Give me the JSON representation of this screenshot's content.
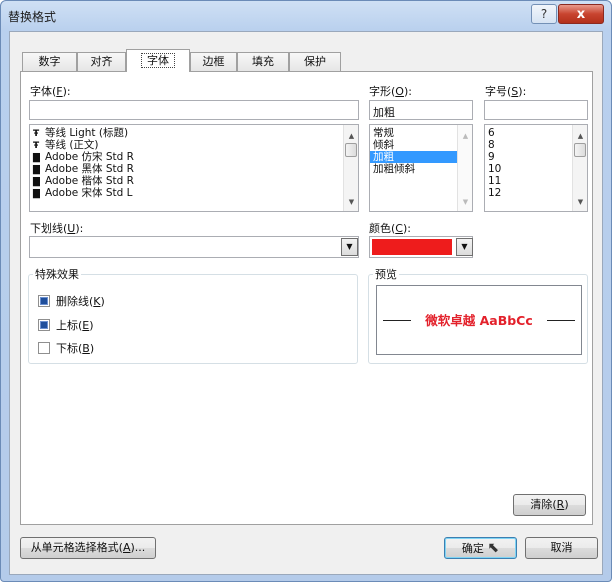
{
  "window": {
    "title": "替换格式",
    "help_glyph": "?",
    "close_glyph": "x"
  },
  "tabs": [
    {
      "label": "数字",
      "active": false
    },
    {
      "label": "对齐",
      "active": false
    },
    {
      "label": "字体",
      "active": true
    },
    {
      "label": "边框",
      "active": false
    },
    {
      "label": "填充",
      "active": false
    },
    {
      "label": "保护",
      "active": false
    }
  ],
  "font": {
    "label": "字体(",
    "key": "F",
    "label_end": "):",
    "value": "",
    "items": [
      {
        "icon": "Tr",
        "name": "等线 Light (标题)"
      },
      {
        "icon": "Tr",
        "name": "等线 (正文)"
      },
      {
        "icon": "printer",
        "name": "Adobe 仿宋 Std R"
      },
      {
        "icon": "printer",
        "name": "Adobe 黑体 Std R"
      },
      {
        "icon": "printer",
        "name": "Adobe 楷体 Std R"
      },
      {
        "icon": "printer",
        "name": "Adobe 宋体 Std L"
      }
    ]
  },
  "style": {
    "label": "字形(",
    "key": "O",
    "label_end": "):",
    "value": "加粗",
    "items": [
      "常规",
      "倾斜",
      "加粗",
      "加粗倾斜"
    ],
    "selected_index": 2
  },
  "size": {
    "label": "字号(",
    "key": "S",
    "label_end": "):",
    "value": "",
    "items": [
      "6",
      "8",
      "9",
      "10",
      "11",
      "12"
    ]
  },
  "underline": {
    "label": "下划线(",
    "key": "U",
    "label_end": "):",
    "value": ""
  },
  "color": {
    "label": "颜色(",
    "key": "C",
    "label_end": "):",
    "value_hex": "#ee1c1c"
  },
  "effects": {
    "legend": "特殊效果",
    "strike": {
      "label": "删除线(",
      "key": "K",
      "label_end": ")",
      "state": "indeterminate"
    },
    "superscript": {
      "label": "上标(",
      "key": "E",
      "label_end": ")",
      "state": "indeterminate"
    },
    "subscript": {
      "label": "下标(",
      "key": "B",
      "label_end": ")",
      "state": "unchecked"
    }
  },
  "preview": {
    "legend": "预览",
    "sample": "微软卓越  AaBbCc",
    "color": "#e3212b"
  },
  "buttons": {
    "clear": {
      "label": "清除(",
      "key": "R",
      "label_end": ")"
    },
    "from_cell": {
      "label": "从单元格选择格式(",
      "key": "A",
      "label_end": ")..."
    },
    "ok": "确定",
    "cancel": "取消"
  }
}
